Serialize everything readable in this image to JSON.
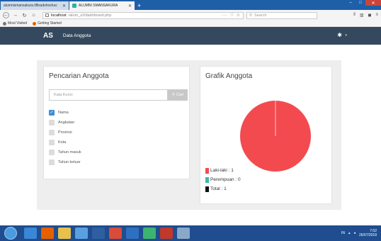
{
  "browser": {
    "tabs": [
      {
        "label": "alumnismansakura.ilflixadshoshuc",
        "active": false
      },
      {
        "label": "ALUMNI SMANSAKURA",
        "active": true
      }
    ],
    "new_tab_label": "+",
    "window_controls": {
      "minimize": "–",
      "maximize": "□",
      "close": "✕"
    },
    "url_host": "localhost",
    "url_path": "/alum_s2/dashboard.php",
    "url_controls": "··· ♡ ☆",
    "search_placeholder": "Search",
    "bookmarks": [
      {
        "label": "Most Visited",
        "icon": "gear-icon"
      },
      {
        "label": "Getting Started",
        "icon": "firefox-icon"
      }
    ]
  },
  "app": {
    "brand": "AS",
    "menu": "Data Anggota"
  },
  "left_panel": {
    "title": "Pencarian Anggota",
    "search_placeholder": "Kata Kunci",
    "search_button": "Cari",
    "filters": [
      {
        "label": "Nama",
        "checked": true
      },
      {
        "label": "Angkatan",
        "checked": false
      },
      {
        "label": "Provinsi",
        "checked": false
      },
      {
        "label": "Kota",
        "checked": false
      },
      {
        "label": "Tahun masuk",
        "checked": false
      },
      {
        "label": "Tahun keluar",
        "checked": false
      }
    ]
  },
  "right_panel": {
    "title": "Grafik Anggota"
  },
  "chart_data": {
    "type": "pie",
    "title": "Grafik Anggota",
    "categories": [
      "Laki-laki",
      "Perempuan",
      "Total"
    ],
    "values": [
      1,
      0,
      1
    ],
    "slices": [
      {
        "label": "Laki-laki",
        "value": 1,
        "color": "#f34a50"
      },
      {
        "label": "Perempuan",
        "value": 0,
        "color": "#3fb7a5"
      }
    ],
    "legend": [
      {
        "text": "Laki-laki : 1",
        "color": "#f34a50"
      },
      {
        "text": "Perempuan : 0",
        "color": "#3fb7a5"
      },
      {
        "text": "Total : 1",
        "color": "#111111"
      }
    ]
  },
  "taskbar": {
    "tray_lang": "IN",
    "time": "7:02",
    "date": "26/07/2018"
  },
  "colors": {
    "header_bg": "#34495e",
    "checked_blue": "#3b8fd6",
    "pie_red": "#f34a50"
  }
}
